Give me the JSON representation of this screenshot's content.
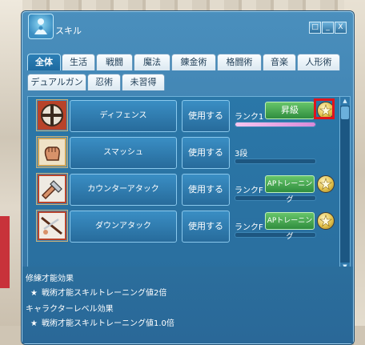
{
  "window": {
    "title": "スキル",
    "controls": {
      "icon": "□",
      "min": "_",
      "close": "X"
    }
  },
  "tabs_row1": [
    {
      "label": "全体",
      "active": true
    },
    {
      "label": "生活",
      "active": false
    },
    {
      "label": "戦闘",
      "active": false
    },
    {
      "label": "魔法",
      "active": false
    },
    {
      "label": "錬金術",
      "active": false
    },
    {
      "label": "格闘術",
      "active": false
    },
    {
      "label": "音楽",
      "active": false
    },
    {
      "label": "人形術",
      "active": false
    }
  ],
  "tabs_row2": [
    {
      "label": "デュアルガン"
    },
    {
      "label": "忍術"
    },
    {
      "label": "未習得"
    }
  ],
  "skills": [
    {
      "name": "ディフェンス",
      "use": "使用する",
      "rank": "ランク1",
      "progress": 1.0,
      "action": "昇級",
      "icon": "shield-icon"
    },
    {
      "name": "スマッシュ",
      "use": "使用する",
      "rank": "3段",
      "progress": 0.0,
      "action": "",
      "icon": "fist-icon"
    },
    {
      "name": "カウンターアタック",
      "use": "使用する",
      "rank": "ランクF",
      "progress": 0.0,
      "action": "APトレーニング",
      "icon": "counter-icon"
    },
    {
      "name": "ダウンアタック",
      "use": "使用する",
      "rank": "ランクF",
      "progress": 0.0,
      "action": "APトレーニング",
      "icon": "down-attack-icon"
    }
  ],
  "bottom": {
    "section1_title": "修練才能効果",
    "section1_item": "戦術才能スキルトレーニング値2倍",
    "section2_title": "キャラクターレベル効果",
    "section2_item": "戦術才能スキルトレーニング値1.0倍"
  },
  "colors": {
    "window": "#3b80b2",
    "tab_active": "#1e6aa0",
    "green_button": "#3a9a47",
    "highlight": "#e0141c"
  }
}
